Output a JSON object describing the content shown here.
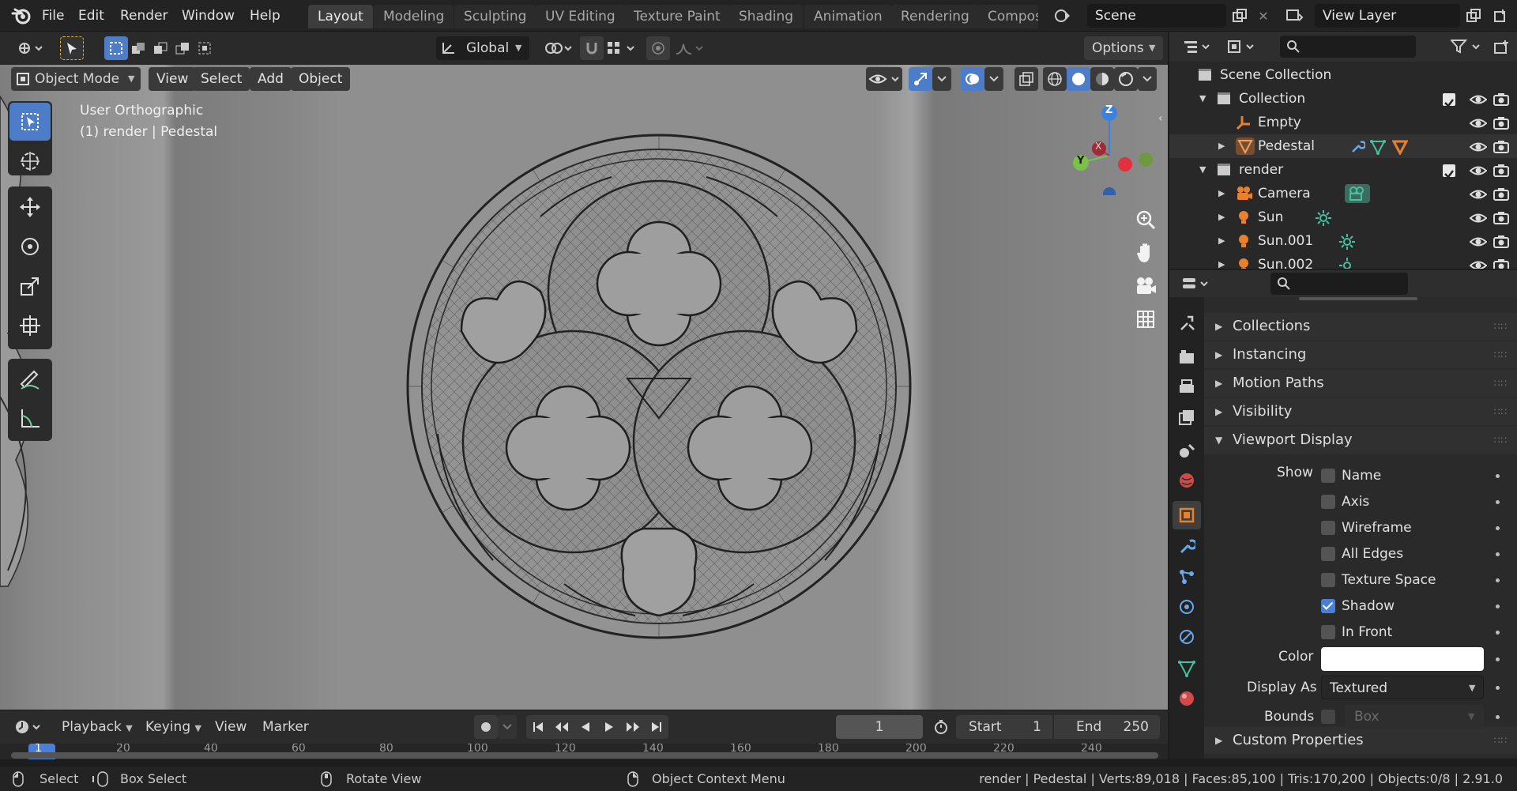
{
  "topbar": {
    "menus": [
      "File",
      "Edit",
      "Render",
      "Window",
      "Help"
    ],
    "workspaces": [
      "Layout",
      "Modeling",
      "Sculpting",
      "UV Editing",
      "Texture Paint",
      "Shading",
      "Animation",
      "Rendering",
      "Compos"
    ],
    "active_workspace": "Layout",
    "scene": "Scene",
    "view_layer": "View Layer"
  },
  "viewport_header": {
    "orientation": "Global",
    "options": "Options",
    "mode": "Object Mode",
    "menus": [
      "View",
      "Select",
      "Add",
      "Object"
    ]
  },
  "viewport": {
    "view_name": "User Orthographic",
    "object_info": "(1) render | Pedestal",
    "gizmo": {
      "z": "Z",
      "y": "Y",
      "x": "X"
    }
  },
  "outliner": {
    "rows": [
      {
        "label": "Scene Collection",
        "icon": "scene-collection-icon"
      },
      {
        "label": "Collection",
        "icon": "collection-icon"
      },
      {
        "label": "Empty",
        "icon": "empty-icon"
      },
      {
        "label": "Pedestal",
        "icon": "mesh-icon"
      },
      {
        "label": "render",
        "icon": "collection-icon"
      },
      {
        "label": "Camera",
        "icon": "camera-icon"
      },
      {
        "label": "Sun",
        "icon": "light-icon"
      },
      {
        "label": "Sun.001",
        "icon": "light-icon"
      },
      {
        "label": "Sun.002",
        "icon": "light-icon"
      }
    ]
  },
  "properties": {
    "sections": [
      "Collections",
      "Instancing",
      "Motion Paths",
      "Visibility",
      "Viewport Display",
      "Custom Properties"
    ],
    "show_label": "Show",
    "checkboxes": [
      {
        "label": "Name",
        "checked": false
      },
      {
        "label": "Axis",
        "checked": false
      },
      {
        "label": "Wireframe",
        "checked": false
      },
      {
        "label": "All Edges",
        "checked": false
      },
      {
        "label": "Texture Space",
        "checked": false
      },
      {
        "label": "Shadow",
        "checked": true
      },
      {
        "label": "In Front",
        "checked": false
      }
    ],
    "color_label": "Color",
    "color_value": "#ffffff",
    "display_as_label": "Display As",
    "display_as_value": "Textured",
    "bounds_label": "Bounds",
    "bounds_value": "Box"
  },
  "timeline": {
    "menus": [
      "Playback",
      "Keying",
      "View",
      "Marker"
    ],
    "current_frame": "1",
    "start_label": "Start",
    "start_value": "1",
    "end_label": "End",
    "end_value": "250",
    "ruler_ticks": [
      "1",
      "20",
      "40",
      "60",
      "80",
      "100",
      "120",
      "140",
      "160",
      "180",
      "200",
      "220",
      "240"
    ]
  },
  "statusbar": {
    "select": "Select",
    "box_select": "Box Select",
    "rotate_view": "Rotate View",
    "context_menu": "Object Context Menu",
    "stats": "render | Pedestal | Verts:89,018 | Faces:85,100 | Tris:170,200 | Objects:0/8 | 2.91.0"
  },
  "colors": {
    "accent": "#4a7fd8",
    "object_orange": "#e8802c",
    "light_green": "#45c0a0",
    "gizmo_z": "#3b82e0",
    "gizmo_y": "#7ac14a",
    "gizmo_x": "#e0313f"
  }
}
